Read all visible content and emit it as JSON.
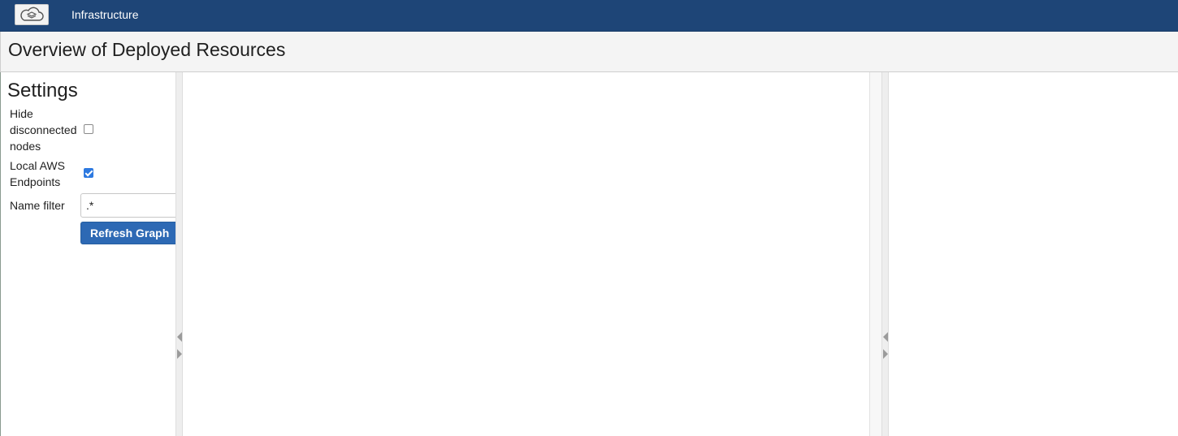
{
  "navbar": {
    "app_title": "Infrastructure",
    "logo_icon": "cloud-layers-icon",
    "background": "#1e4577"
  },
  "page": {
    "title": "Overview of Deployed Resources"
  },
  "settings": {
    "title": "Settings",
    "hide_disconnected": {
      "label_lines": [
        "Hide",
        "disconnected",
        "nodes"
      ],
      "checked": false
    },
    "local_aws": {
      "label_lines": [
        "Local AWS",
        "Endpoints"
      ],
      "checked": true
    },
    "name_filter": {
      "label": "Name filter",
      "value": ".*"
    },
    "refresh_label": "Refresh Graph"
  },
  "colors": {
    "button": "#2d69b4",
    "checkbox_checked": "#2d79e0"
  }
}
